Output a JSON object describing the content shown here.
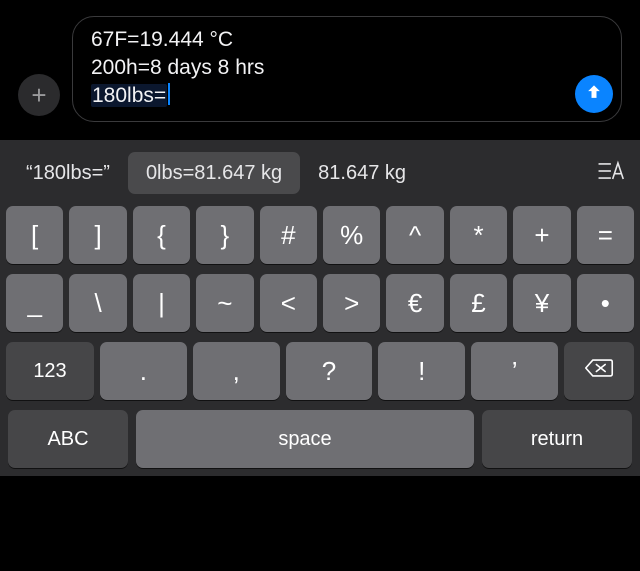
{
  "input": {
    "lines": {
      "0": "67F=19.444 °C",
      "1": "200h=8 days 8 hrs",
      "active": "180lbs="
    }
  },
  "suggestions": {
    "0": "“180lbs=”",
    "1": "0lbs=81.647 kg",
    "2": "81.647 kg"
  },
  "keys": {
    "r1": {
      "0": "[",
      "1": "]",
      "2": "{",
      "3": "}",
      "4": "#",
      "5": "%",
      "6": "^",
      "7": "*",
      "8": "+",
      "9": "="
    },
    "r2": {
      "0": "_",
      "1": "\\",
      "2": "|",
      "3": "~",
      "4": "<",
      "5": ">",
      "6": "€",
      "7": "£",
      "8": "¥",
      "9": "•"
    },
    "r3": {
      "num": "123",
      "0": ".",
      "1": ",",
      "2": "?",
      "3": "!",
      "4": "’"
    },
    "r4": {
      "abc": "ABC",
      "space": "space",
      "return": "return"
    }
  }
}
